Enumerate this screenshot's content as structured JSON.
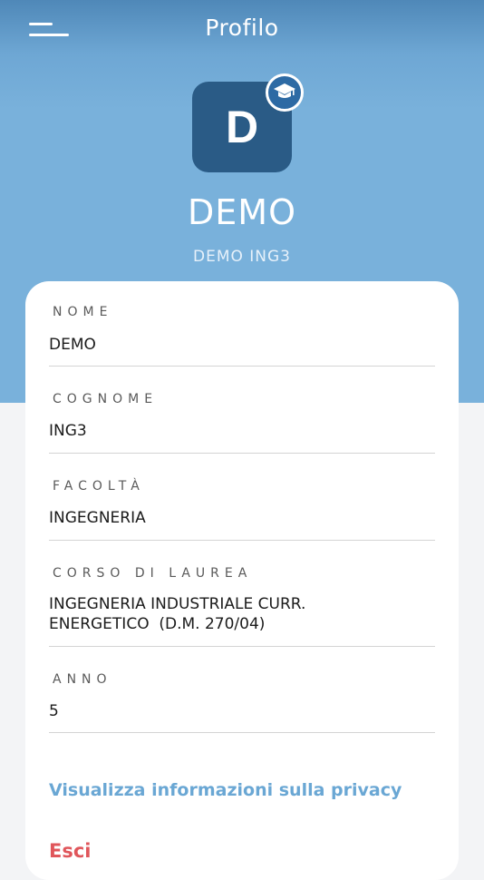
{
  "header": {
    "title": "Profilo",
    "menu_icon": "hamburger-menu-icon"
  },
  "profile": {
    "avatar_letter": "D",
    "badge_icon": "graduation-cap-icon",
    "name": "DEMO",
    "subtitle": "DEMO ING3"
  },
  "fields": [
    {
      "label": "NOME",
      "value": "DEMO"
    },
    {
      "label": "COGNOME",
      "value": "ING3"
    },
    {
      "label": "FACOLTÀ",
      "value": "INGEGNERIA"
    },
    {
      "label": "CORSO DI LAUREA",
      "value_line1": "INGEGNERIA INDUSTRIALE CURR.",
      "value_line2": "ENERGETICO  (D.M. 270/04)"
    },
    {
      "label": "ANNO",
      "value": "5"
    }
  ],
  "links": {
    "privacy": "Visualizza informazioni sulla privacy",
    "logout": "Esci"
  },
  "colors": {
    "header_blue": "#79b1db",
    "avatar_blue": "#2a5b86",
    "link_blue": "#6aa7d4",
    "logout_red": "#e0565b"
  }
}
